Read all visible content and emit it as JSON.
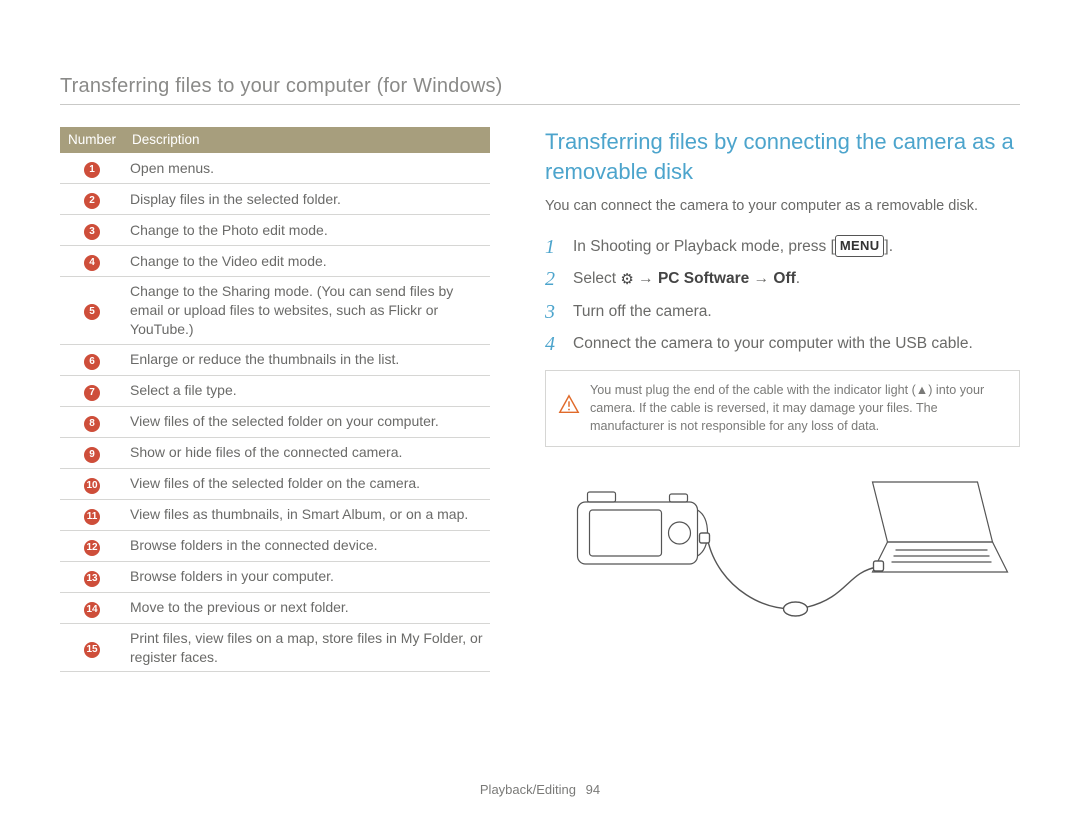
{
  "page_header": "Transferring files to your computer (for Windows)",
  "table": {
    "head": {
      "number": "Number",
      "description": "Description"
    },
    "rows": [
      {
        "n": "1",
        "desc": "Open menus."
      },
      {
        "n": "2",
        "desc": "Display files in the selected folder."
      },
      {
        "n": "3",
        "desc": "Change to the Photo edit mode."
      },
      {
        "n": "4",
        "desc": "Change to the Video edit mode."
      },
      {
        "n": "5",
        "desc": "Change to the Sharing mode. (You can send files by email or upload files to websites, such as Flickr or YouTube.)"
      },
      {
        "n": "6",
        "desc": "Enlarge or reduce the thumbnails in the list."
      },
      {
        "n": "7",
        "desc": "Select a file type."
      },
      {
        "n": "8",
        "desc": "View files of the selected folder on your computer."
      },
      {
        "n": "9",
        "desc": "Show or hide files of the connected camera."
      },
      {
        "n": "10",
        "desc": "View files of the selected folder on the camera."
      },
      {
        "n": "11",
        "desc": "View files as thumbnails, in Smart Album, or on a map."
      },
      {
        "n": "12",
        "desc": "Browse folders in the connected device."
      },
      {
        "n": "13",
        "desc": "Browse folders in your computer."
      },
      {
        "n": "14",
        "desc": "Move to the previous or next folder."
      },
      {
        "n": "15",
        "desc": "Print files, view files on a map, store files in My Folder, or register faces."
      }
    ]
  },
  "section_title": "Transferring files by connecting the camera as a removable disk",
  "intro": "You can connect the camera to your computer as a removable disk.",
  "steps": {
    "s1_a": "In Shooting or Playback mode, press [",
    "s1_menu": "MENU",
    "s1_b": "].",
    "s2_a": "Select ",
    "s2_arrow1": " → ",
    "s2_pc": "PC Software",
    "s2_arrow2": " → ",
    "s2_off": "Off",
    "s2_b": ".",
    "s3": "Turn off the camera.",
    "s4": "Connect the camera to your computer with the USB cable."
  },
  "caution": "You must plug the end of the cable with the indicator light (▲) into your camera. If the cable is reversed, it may damage your files. The manufacturer is not responsible for any loss of data.",
  "footer": {
    "section": "Playback/Editing",
    "page": "94"
  }
}
